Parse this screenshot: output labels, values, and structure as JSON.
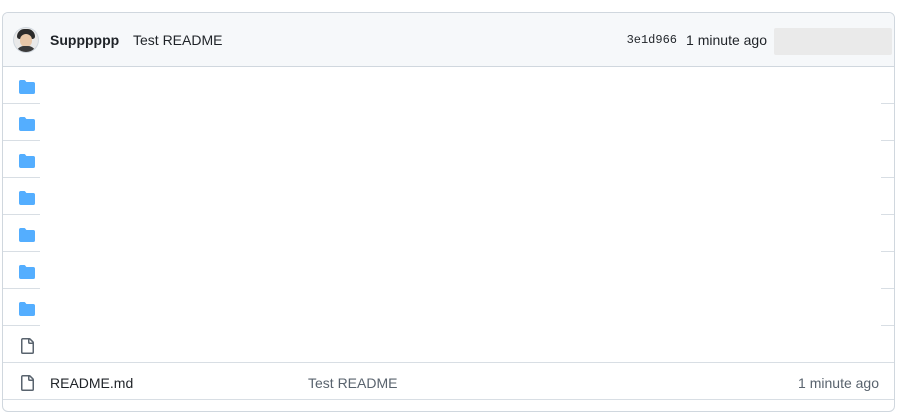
{
  "latest_commit": {
    "author": "Supppppp",
    "message": "Test README",
    "sha": "3e1d966",
    "time": "1 minute ago"
  },
  "rows": [
    {
      "type": "folder",
      "icon": "folder-icon",
      "name": "",
      "commit": "",
      "time": ""
    },
    {
      "type": "folder",
      "icon": "folder-icon",
      "name": "",
      "commit": "",
      "time": ""
    },
    {
      "type": "folder",
      "icon": "folder-icon",
      "name": "",
      "commit": "",
      "time": ""
    },
    {
      "type": "folder",
      "icon": "folder-icon",
      "name": "",
      "commit": "",
      "time": ""
    },
    {
      "type": "folder",
      "icon": "folder-icon",
      "name": "",
      "commit": "",
      "time": ""
    },
    {
      "type": "folder",
      "icon": "folder-icon",
      "name": "",
      "commit": "",
      "time": ""
    },
    {
      "type": "folder",
      "icon": "folder-icon",
      "name": "",
      "commit": "",
      "time": ""
    },
    {
      "type": "file",
      "icon": "file-icon",
      "name": "",
      "commit": "",
      "time": ""
    },
    {
      "type": "file",
      "icon": "file-icon",
      "name": "README.md",
      "commit": "Test README",
      "time": "1 minute ago"
    }
  ],
  "colors": {
    "folder": "#54aeff",
    "file": "#59636e",
    "border": "#d0d7de",
    "header_bg": "#f6f8fa"
  }
}
